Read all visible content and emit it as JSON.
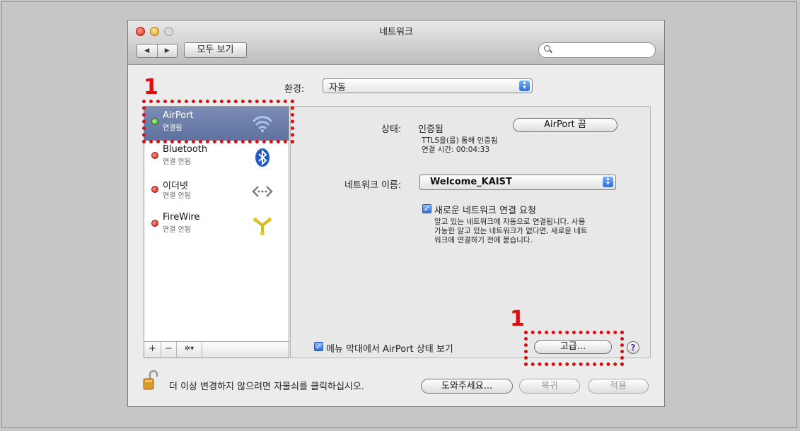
{
  "window": {
    "title": "네트워크"
  },
  "toolbar": {
    "back_label": "◀",
    "forward_label": "▶",
    "show_all_label": "모두 보기",
    "search_placeholder": ""
  },
  "location": {
    "label": "환경:",
    "value": "자동"
  },
  "services": [
    {
      "name": "AirPort",
      "status": "연결됨",
      "status_color": "#36a516",
      "icon": "wifi-icon",
      "selected": true
    },
    {
      "name": "Bluetooth",
      "status": "연결 안됨",
      "status_color": "#c81d12",
      "icon": "bluetooth-icon"
    },
    {
      "name": "이더넷",
      "status": "연결 안됨",
      "status_color": "#c81d12",
      "icon": "ethernet-icon"
    },
    {
      "name": "FireWire",
      "status": "연결 안됨",
      "status_color": "#c81d12",
      "icon": "firewire-icon"
    }
  ],
  "list_toolbar": {
    "add": "+",
    "remove": "−",
    "action": "✲▾"
  },
  "detail": {
    "status_label": "상태:",
    "status_value": "인증됨",
    "airport_off_button": "AirPort 끔",
    "status_line1": "TTLS을(를) 통해 인증됨",
    "status_line2": "연결 시간: 00:04:33",
    "network_name_label": "네트워크 이름:",
    "network_name_value": "Welcome_KAIST",
    "ask_join_label": "새로운 네트워크 연결 요청",
    "ask_join_desc1": "알고 있는 네트워크에 자동으로 연결됩니다. 사용",
    "ask_join_desc2": "가능한 알고 있는 네트워크가 없다면, 새로운 네트",
    "ask_join_desc3": "워크에 연결하기 전에 묻습니다.",
    "menubar_label": "메뉴 막대에서 AirPort 상태 보기",
    "advanced_button": "고급...",
    "help_label": "?"
  },
  "footer": {
    "lock_text": "더 이상 변경하지 않으려면 자물쇠를 클릭하십시오.",
    "assist_button": "도와주세요...",
    "revert_button": "복귀",
    "apply_button": "적용"
  },
  "annotations": {
    "callout_1": "1",
    "callout_2": "1",
    "color": "#e10c0c"
  }
}
